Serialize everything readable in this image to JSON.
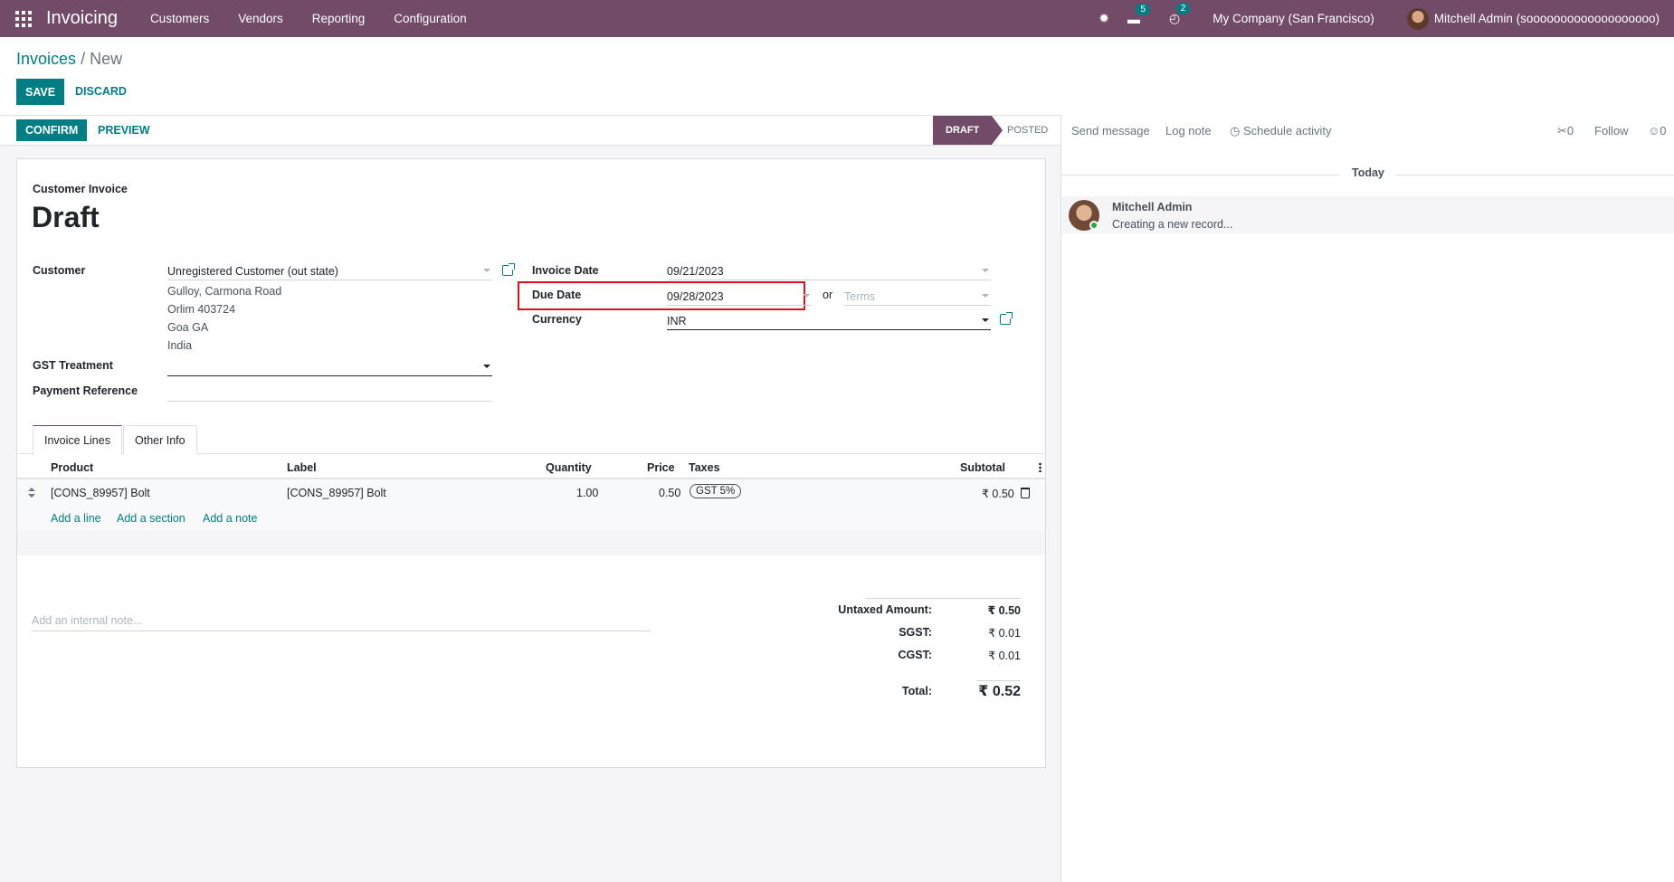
{
  "navbar": {
    "app_name": "Invoicing",
    "menu": [
      "Customers",
      "Vendors",
      "Reporting",
      "Configuration"
    ],
    "bug_icon": "✹",
    "chat_icon": "▬",
    "chat_badge": "5",
    "activity_icon": "◴",
    "activity_badge": "2",
    "company": "My Company (San Francisco)",
    "user": "Mitchell Admin (sooooooooooooooooooo)"
  },
  "breadcrumb": {
    "parent": "Invoices",
    "separator": "/",
    "current": "New"
  },
  "buttons": {
    "save": "SAVE",
    "discard": "DISCARD",
    "confirm": "CONFIRM",
    "preview": "PREVIEW"
  },
  "status": {
    "draft": "DRAFT",
    "posted": "POSTED"
  },
  "form": {
    "subtitle": "Customer Invoice",
    "title": "Draft",
    "customer_label": "Customer",
    "customer_value": "Unregistered Customer (out state)",
    "address": [
      "Gulloy, Carmona Road",
      "Orlim 403724",
      "Goa GA",
      "India"
    ],
    "gst_label": "GST Treatment",
    "gst_value": "",
    "payref_label": "Payment Reference",
    "payref_value": "",
    "invoice_date_label": "Invoice Date",
    "invoice_date_value": "09/21/2023",
    "due_date_label": "Due Date",
    "due_date_value": "09/28/2023",
    "or_text": "or",
    "terms_placeholder": "Terms",
    "currency_label": "Currency",
    "currency_value": "INR"
  },
  "tabs": [
    "Invoice Lines",
    "Other Info"
  ],
  "table": {
    "headers": {
      "product": "Product",
      "label": "Label",
      "quantity": "Quantity",
      "price": "Price",
      "taxes": "Taxes",
      "subtotal": "Subtotal"
    },
    "rows": [
      {
        "product": "[CONS_89957] Bolt",
        "label": "[CONS_89957] Bolt",
        "quantity": "1.00",
        "price": "0.50",
        "tax": "GST 5%",
        "subtotal": "₹ 0.50"
      }
    ],
    "add_line": "Add a line",
    "add_section": "Add a section",
    "add_note": "Add a note"
  },
  "note_placeholder": "Add an internal note...",
  "totals": {
    "untaxed_label": "Untaxed Amount:",
    "untaxed_value": "₹ 0.50",
    "sgst_label": "SGST:",
    "sgst_value": "₹ 0.01",
    "cgst_label": "CGST:",
    "cgst_value": "₹ 0.01",
    "total_label": "Total:",
    "total_value": "₹ 0.52"
  },
  "chatter": {
    "send_message": "Send message",
    "log_note": "Log note",
    "schedule_icon": "◷",
    "schedule_activity": "Schedule activity",
    "attachments_icon": "✂",
    "attachments_count": "0",
    "follow": "Follow",
    "followers_icon": "☺",
    "followers_count": "0",
    "today": "Today",
    "message_author": "Mitchell Admin",
    "message_body": "Creating a new record..."
  }
}
